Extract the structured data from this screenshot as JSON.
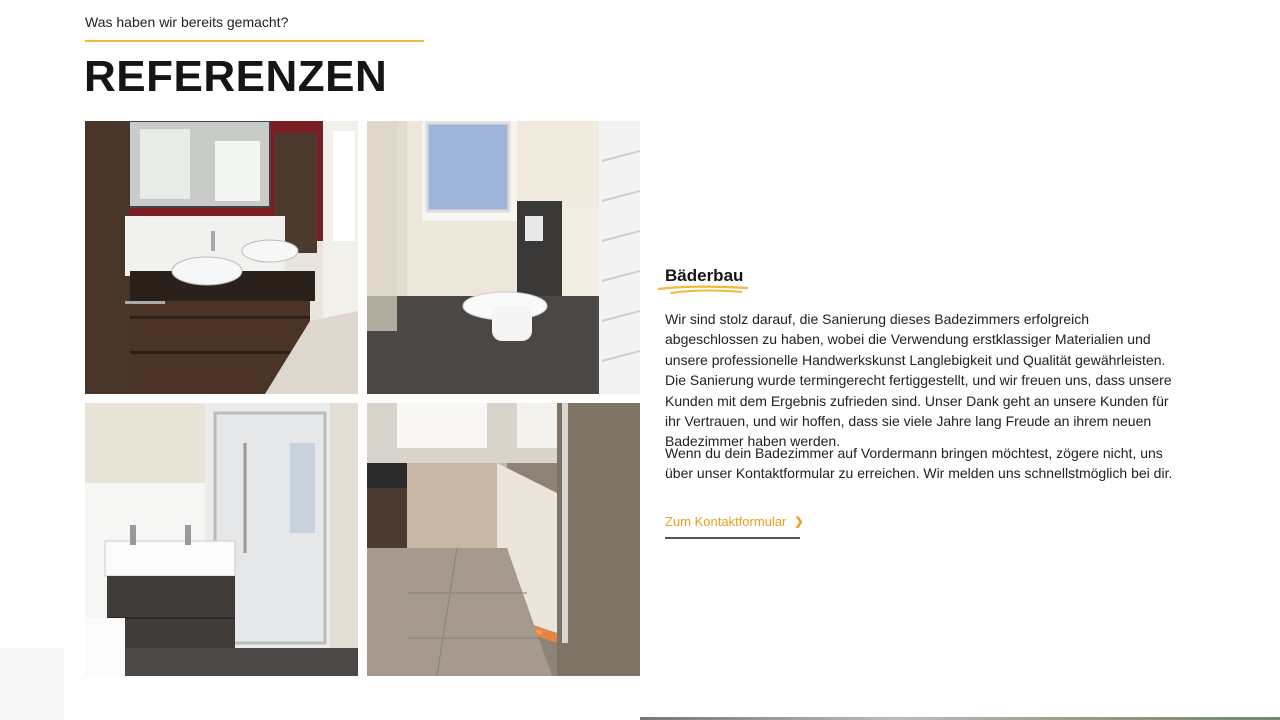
{
  "header": {
    "eyebrow": "Was haben wir bereits gemacht?",
    "title": "REFERENZEN"
  },
  "gallery": {
    "images": [
      {
        "subject": "bathroom-vanity-double-sink"
      },
      {
        "subject": "bathroom-wall-toilet-window"
      },
      {
        "subject": "bathroom-shower-washbasin"
      },
      {
        "subject": "bathroom-led-partition-wall"
      }
    ]
  },
  "content": {
    "heading": "Bäderbau",
    "paragraph1": "Wir sind stolz darauf, die Sanierung dieses Badezimmers erfolgreich abgeschlossen zu haben, wobei die Verwendung erstklassiger Materialien und unsere professionelle Handwerkskunst Langlebigkeit und Qualität gewährleisten. Die Sanierung wurde termingerecht fertiggestellt, und wir freuen uns, dass unsere Kunden mit dem Ergebnis zufrieden sind. Unser Dank geht an unsere Kunden für ihr Vertrauen, und wir hoffen, dass sie viele Jahre lang Freude an ihrem neuen Badezimmer haben werden.",
    "paragraph2": "Wenn du dein Badezimmer auf Vordermann bringen möchtest, zögere nicht, uns über unser Kontaktformular zu erreichen. Wir melden uns schnellstmöglich bei dir.",
    "cta_label": "Zum Kontaktformular",
    "cta_icon": "chevron-right-icon"
  },
  "colors": {
    "accent": "#f2b93b",
    "cta_text": "#e8a21c",
    "text": "#1a1a1a"
  }
}
